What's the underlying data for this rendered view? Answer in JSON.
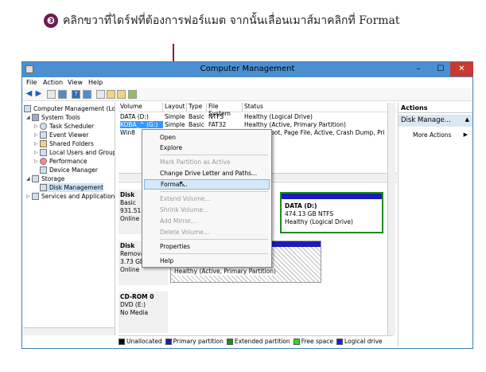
{
  "instruction": {
    "step_number": "❸",
    "text": "คลิกขวาที่ไดร์ฟที่ต้องการฟอร์แมต จากนั้นเลื่อนเมาส์มาคลิกที่ Format"
  },
  "window": {
    "title": "Computer Management",
    "min": "–",
    "max": "☐",
    "close": "✕"
  },
  "menu": [
    "File",
    "Action",
    "View",
    "Help"
  ],
  "tree": {
    "root": "Computer Management (Local",
    "system_tools": "System Tools",
    "task_scheduler": "Task Scheduler",
    "event_viewer": "Event Viewer",
    "shared_folders": "Shared Folders",
    "local_users": "Local Users and Groups",
    "performance": "Performance",
    "device_manager": "Device Manager",
    "storage": "Storage",
    "disk_management": "Disk Management",
    "services": "Services and Applications"
  },
  "columns": [
    "Volume",
    "Layout",
    "Type",
    "File System",
    "Status"
  ],
  "volumes": [
    {
      "name": "DATA (D:)",
      "layout": "Simple",
      "type": "Basic",
      "fs": "NTFS",
      "status": "Healthy (Logical Drive)"
    },
    {
      "name": "KOBA_^ (G:)",
      "layout": "Simple",
      "type": "Basic",
      "fs": "FAT32",
      "status": "Healthy (Active, Primary Partition)"
    },
    {
      "name": "Win8",
      "layout": "",
      "type": "",
      "fs": "",
      "status": "ystem, Boot, Page File, Active, Crash Dump, Pri"
    }
  ],
  "disks": [
    {
      "name": "Disk",
      "lines": [
        "Basic",
        "931.51 G",
        "Online"
      ]
    },
    {
      "name": "Disk",
      "lines": [
        "Remova",
        "3.73 GB",
        "Online"
      ]
    },
    {
      "name": "CD-ROM 0",
      "lines": [
        "DVD (E:)",
        "",
        "No Media"
      ]
    }
  ],
  "partitions": {
    "data_d": {
      "name": "DATA (D:)",
      "size": "474.13 GB NTFS",
      "status": "Healthy (Logical Drive)"
    },
    "removable": {
      "status": "Healthy (Active, Primary Partition)"
    }
  },
  "legend": [
    {
      "label": "Unallocated",
      "color": "#000000"
    },
    {
      "label": "Primary partition",
      "color": "#1b1bb8"
    },
    {
      "label": "Extended partition",
      "color": "#1e8b1e"
    },
    {
      "label": "Free space",
      "color": "#22dd22"
    },
    {
      "label": "Logical drive",
      "color": "#1b1bff"
    }
  ],
  "actions": {
    "header": "Actions",
    "section": "Disk Manage...",
    "more": "More Actions"
  },
  "context_menu": {
    "open": "Open",
    "explore": "Explore",
    "mark_active": "Mark Partition as Active",
    "change_letter": "Change Drive Letter and Paths...",
    "format": "Format...",
    "extend": "Extend Volume...",
    "shrink": "Shrink Volume...",
    "add_mirror": "Add Mirror...",
    "delete": "Delete Volume...",
    "properties": "Properties",
    "help": "Help"
  }
}
